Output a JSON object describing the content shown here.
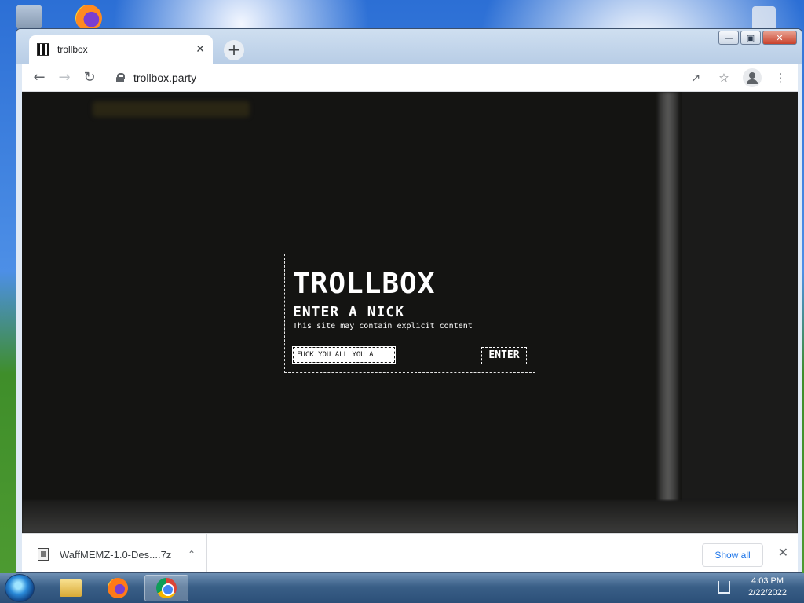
{
  "browser": {
    "tab": {
      "title": "trollbox"
    },
    "address": {
      "url": "trollbox.party"
    }
  },
  "page": {
    "modal": {
      "title": "TROLLBOX",
      "subtitle": "ENTER A NICK",
      "warning": "This site may contain explicit content",
      "nick_value": "FUCK YOU ALL YOU A",
      "enter_label": "ENTER"
    }
  },
  "downloads": {
    "item": {
      "filename": "WaffMEMZ-1.0-Des....7z"
    },
    "show_all_label": "Show all"
  },
  "taskbar": {
    "time": "4:03 PM",
    "date": "2/22/2022"
  },
  "icons": {
    "window_minimize": "minimize-icon",
    "window_restore": "restore-icon",
    "window_close": "close-icon"
  }
}
